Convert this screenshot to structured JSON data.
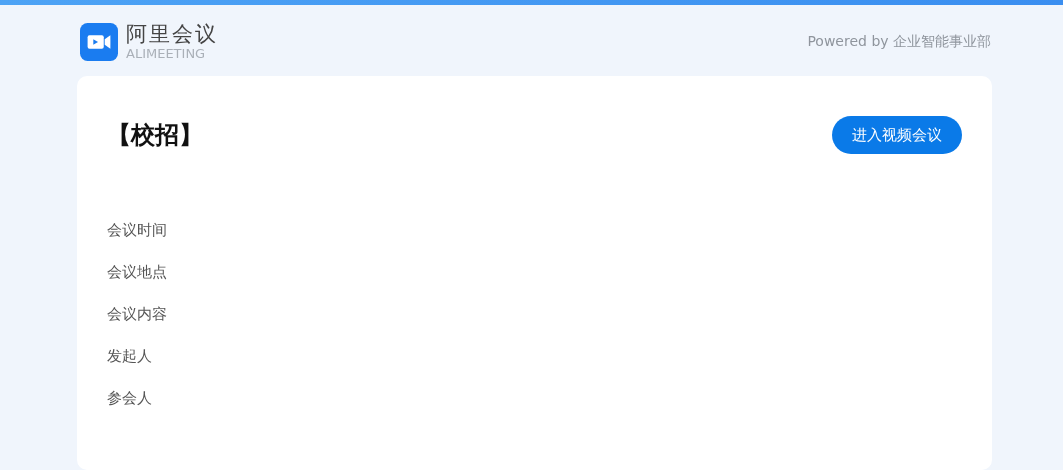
{
  "header": {
    "logo_title": "阿里会议",
    "logo_subtitle": "ALIMEETING",
    "powered_by": "Powered by 企业智能事业部"
  },
  "meeting": {
    "title": "【校招】",
    "join_button": "进入视频会议",
    "fields": [
      {
        "label": "会议时间"
      },
      {
        "label": "会议地点"
      },
      {
        "label": "会议内容"
      },
      {
        "label": "发起人"
      },
      {
        "label": "参会人"
      }
    ]
  }
}
